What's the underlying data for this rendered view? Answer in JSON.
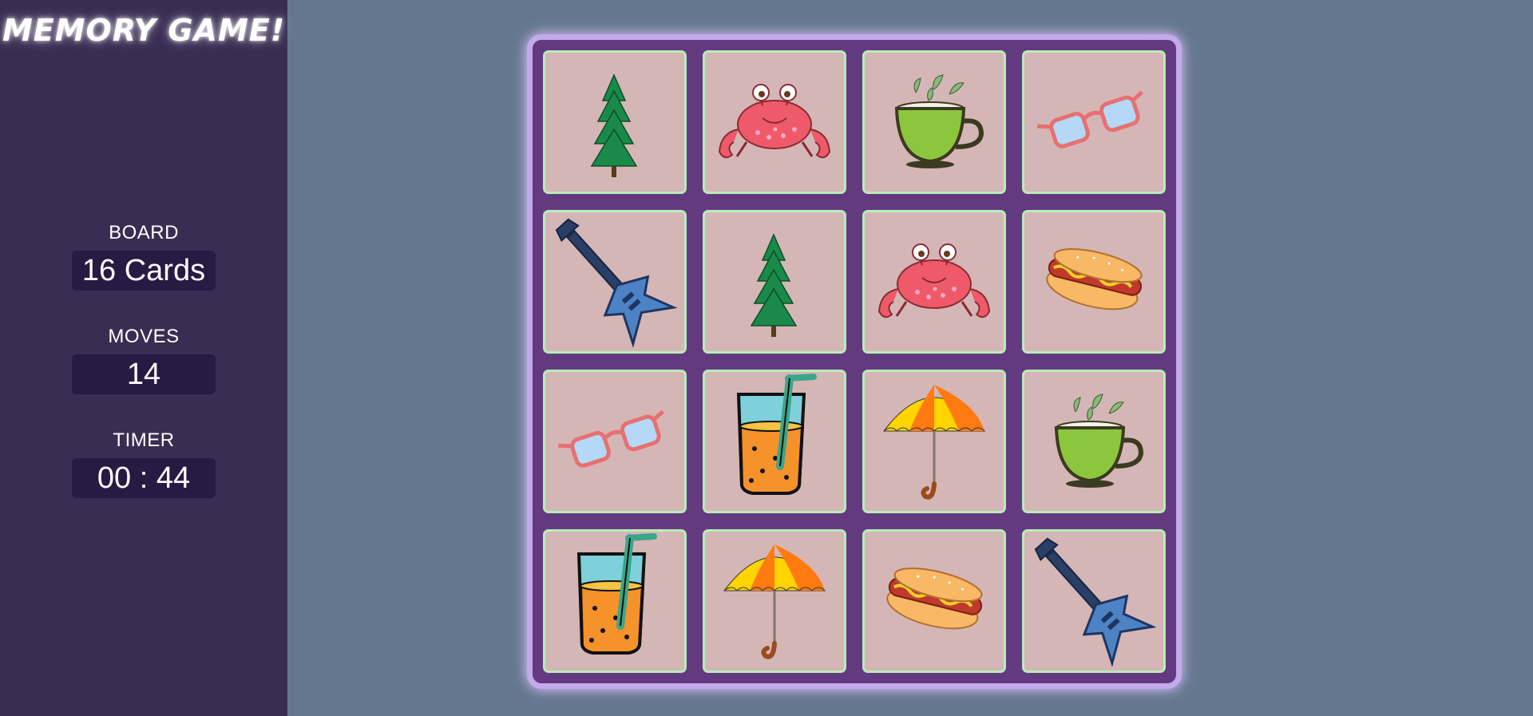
{
  "app": {
    "title": "MEMORY GAME!"
  },
  "stats": {
    "board": {
      "label": "BOARD",
      "value": "16 Cards"
    },
    "moves": {
      "label": "MOVES",
      "value": "14"
    },
    "timer": {
      "label": "TIMER",
      "value": "00 : 44"
    }
  },
  "board": {
    "columns": 4,
    "rows": 4,
    "cards": [
      {
        "icon": "pine-tree-icon"
      },
      {
        "icon": "crab-icon"
      },
      {
        "icon": "tea-cup-icon"
      },
      {
        "icon": "sunglasses-icon"
      },
      {
        "icon": "electric-guitar-icon"
      },
      {
        "icon": "pine-tree-icon"
      },
      {
        "icon": "crab-icon"
      },
      {
        "icon": "hot-dog-icon"
      },
      {
        "icon": "sunglasses-icon"
      },
      {
        "icon": "juice-glass-icon"
      },
      {
        "icon": "umbrella-icon"
      },
      {
        "icon": "tea-cup-icon"
      },
      {
        "icon": "juice-glass-icon"
      },
      {
        "icon": "umbrella-icon"
      },
      {
        "icon": "hot-dog-icon"
      },
      {
        "icon": "electric-guitar-icon"
      }
    ]
  },
  "colors": {
    "background": "#65778f",
    "sidebar": "#3a2d53",
    "stat_box": "#251b43",
    "board": "#633a80",
    "board_border": "#c4a9ec",
    "card_face": "#d5b6b6",
    "card_border": "#b8ecb8"
  }
}
